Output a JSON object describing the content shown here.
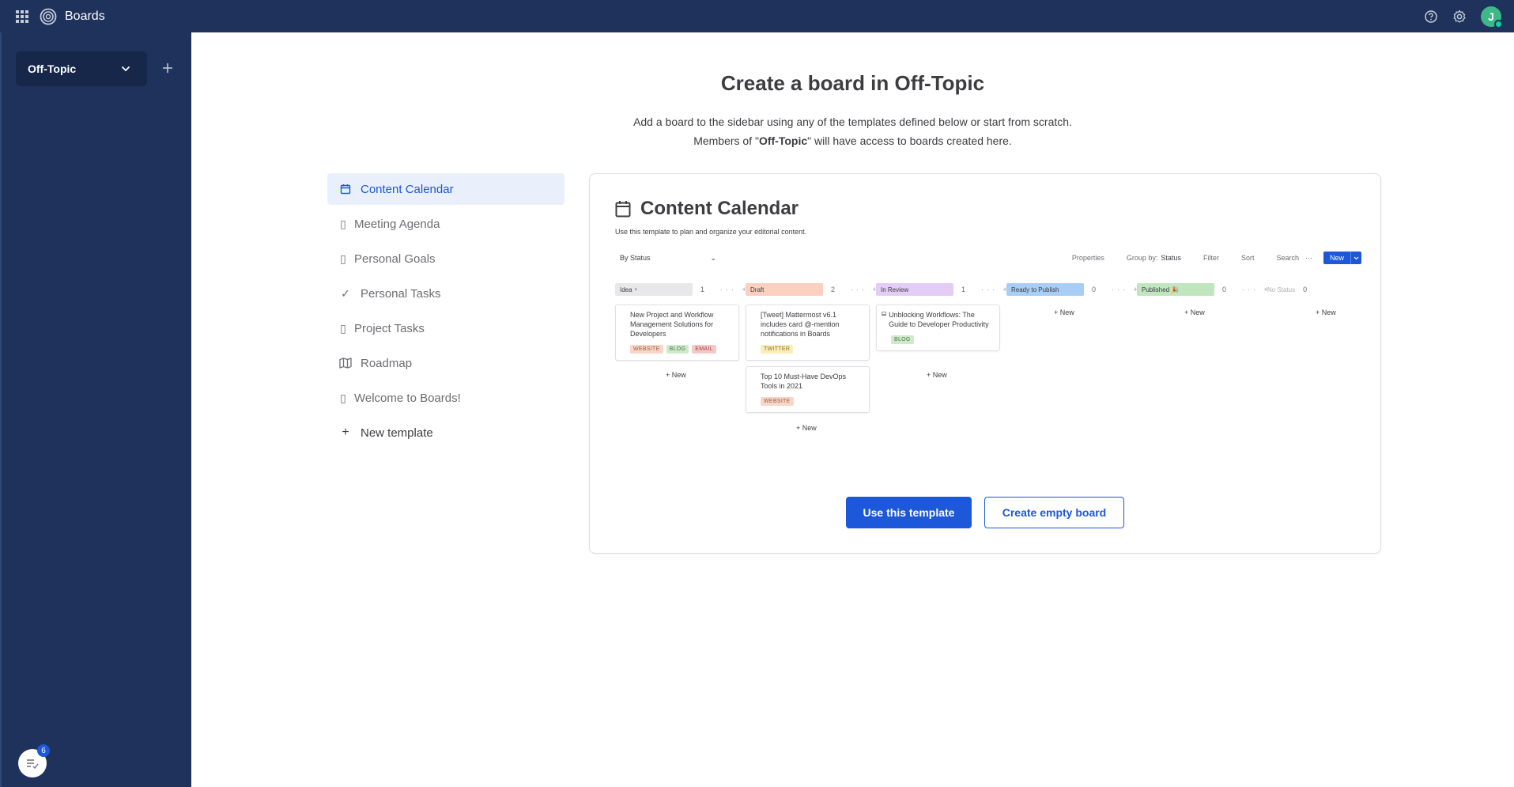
{
  "topbar": {
    "app_title": "Boards",
    "avatar_initial": "J",
    "icons": [
      "apps-grid-icon",
      "boards-logo-icon",
      "help-icon",
      "settings-icon"
    ]
  },
  "sidebar": {
    "team_name": "Off-Topic",
    "notification_count": "6"
  },
  "main": {
    "title": "Create a board in Off-Topic",
    "subtitle_line1": "Add a board to the sidebar using any of the templates defined below or start from scratch.",
    "subtitle_prefix": "Members of \"",
    "subtitle_team": "Off-Topic",
    "subtitle_suffix": "\" will have access to boards created here."
  },
  "templates": [
    {
      "label": "Content Calendar",
      "icon": "calendar-icon",
      "active": true
    },
    {
      "label": "Meeting Agenda",
      "icon": "placeholder-icon",
      "active": false
    },
    {
      "label": "Personal Goals",
      "icon": "placeholder-icon",
      "active": false
    },
    {
      "label": "Personal Tasks",
      "icon": "check-icon",
      "active": false
    },
    {
      "label": "Project Tasks",
      "icon": "placeholder-icon",
      "active": false
    },
    {
      "label": "Roadmap",
      "icon": "map-icon",
      "active": false
    },
    {
      "label": "Welcome to Boards!",
      "icon": "placeholder-icon",
      "active": false
    },
    {
      "label": "New template",
      "icon": "plus-icon",
      "active": false
    }
  ],
  "preview": {
    "title": "Content Calendar",
    "description": "Use this template to plan and organize your editorial content.",
    "view_selector": "By Status",
    "toolbar": {
      "properties": "Properties",
      "group_by_label": "Group by:",
      "group_by_value": "Status",
      "filter": "Filter",
      "sort": "Sort",
      "search": "Search",
      "more": "···",
      "new": "New"
    },
    "columns": [
      {
        "name": "Idea",
        "count": "1",
        "color": "#e8e8ea"
      },
      {
        "name": "Draft",
        "count": "2",
        "color": "#fcd0c0"
      },
      {
        "name": "In Review",
        "count": "1",
        "color": "#e3cdf7"
      },
      {
        "name": "Ready to Publish",
        "count": "0",
        "color": "#a8cef5"
      },
      {
        "name": "Published 🎉",
        "count": "0",
        "color": "#bfe6bf"
      }
    ],
    "no_status": {
      "name": "No Status",
      "count": "0"
    },
    "column_actions": "··· +",
    "new_label": "+ New",
    "cards": [
      {
        "title": "New Project and Workflow Management Solutions for Developers",
        "tags": [
          "WEBSITE",
          "BLOG",
          "EMAIL"
        ]
      },
      {
        "title": "[Tweet] Mattermost v6.1 includes card @-mention notifications in Boards",
        "tags": [
          "TWITTER"
        ]
      },
      {
        "title": "Top 10 Must-Have DevOps Tools in 2021",
        "tags": [
          "WEBSITE"
        ]
      },
      {
        "title": "Unblocking Workflows: The Guide to Developer Productivity",
        "tags": [
          "BLOG"
        ]
      }
    ]
  },
  "actions": {
    "use_template": "Use this template",
    "create_empty": "Create empty board"
  },
  "colors": {
    "sidebar_bg": "#1e325c",
    "accent": "#1c58d9",
    "active_bg": "#e9f0fc"
  }
}
